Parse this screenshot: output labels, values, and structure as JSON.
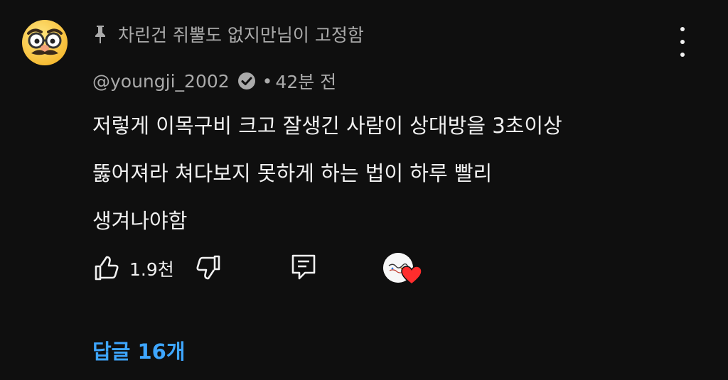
{
  "comment": {
    "pinned_text": "차린건 쥐뿔도 없지만님이 고정함",
    "author": "@youngji_2002",
    "time": "42분 전",
    "separator": "•",
    "body_lines": [
      "저렇게 이목구비 크고 잘생긴 사람이 상대방을 3초이상",
      "뚫어져라 쳐다보지 못하게 하는 법이 하루 빨리",
      "생겨나야함"
    ],
    "likes": "1.9천",
    "replies_label": "답글 16개"
  },
  "icons": {
    "avatar": "disguise-face-emoji",
    "pin": "pin-icon",
    "more": "more-vert-icon",
    "verified": "verified-check-icon",
    "like": "thumb-up-icon",
    "dislike": "thumb-down-icon",
    "reply": "comment-reply-icon",
    "heart": "creator-heart-icon"
  },
  "colors": {
    "background": "#0f0f0f",
    "primary_text": "#f1f1f1",
    "secondary_text": "#aaaaaa",
    "link": "#3ea6ff",
    "heart": "#ff2d2d"
  }
}
